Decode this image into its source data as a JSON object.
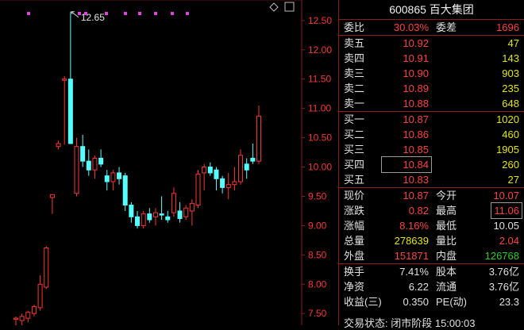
{
  "chart_data": {
    "type": "candlestick",
    "y_ticks": [
      "12.50",
      "12.00",
      "11.50",
      "11.00",
      "10.50",
      "10.00",
      "9.50",
      "9.00",
      "8.50",
      "8.00",
      "7.50"
    ],
    "y_tick_values": [
      12.5,
      12.0,
      11.5,
      11.0,
      10.5,
      10.0,
      9.5,
      9.0,
      8.5,
      8.0,
      7.5
    ],
    "ylim": [
      7.3,
      12.85
    ],
    "high_annotation": "12.65",
    "high_value": 12.65,
    "up_color": "#ff3333",
    "down_color": "#54ffff",
    "marker_color": "#e040e0",
    "candles": [
      {
        "o": 7.4,
        "h": 7.45,
        "l": 7.3,
        "c": 7.42
      },
      {
        "o": 7.38,
        "h": 7.5,
        "l": 7.3,
        "c": 7.45
      },
      {
        "o": 7.42,
        "h": 7.55,
        "l": 7.35,
        "c": 7.52
      },
      {
        "o": 7.5,
        "h": 7.65,
        "l": 7.45,
        "c": 7.62
      },
      {
        "o": 7.6,
        "h": 8.15,
        "l": 7.55,
        "c": 8.0
      },
      {
        "o": 7.95,
        "h": 8.65,
        "l": 7.92,
        "c": 8.62
      },
      {
        "o": 9.48,
        "h": 9.5,
        "l": 9.2,
        "c": 9.53
      },
      {
        "o": 10.35,
        "h": 10.45,
        "l": 10.3,
        "c": 10.4
      },
      {
        "o": 11.48,
        "h": 11.55,
        "l": 10.38,
        "c": 11.5
      },
      {
        "o": 11.5,
        "h": 12.65,
        "l": 10.4,
        "c": 10.4
      },
      {
        "o": 9.55,
        "h": 10.5,
        "l": 9.5,
        "c": 10.35
      },
      {
        "o": 10.35,
        "h": 10.55,
        "l": 10.0,
        "c": 10.1
      },
      {
        "o": 10.1,
        "h": 10.3,
        "l": 9.85,
        "c": 9.95
      },
      {
        "o": 9.95,
        "h": 10.2,
        "l": 9.8,
        "c": 10.15
      },
      {
        "o": 10.15,
        "h": 10.3,
        "l": 10.0,
        "c": 10.05
      },
      {
        "o": 9.85,
        "h": 9.95,
        "l": 9.6,
        "c": 9.75
      },
      {
        "o": 9.75,
        "h": 9.95,
        "l": 9.6,
        "c": 9.9
      },
      {
        "o": 9.9,
        "h": 10.0,
        "l": 9.7,
        "c": 9.8
      },
      {
        "o": 9.85,
        "h": 9.9,
        "l": 9.25,
        "c": 9.35
      },
      {
        "o": 9.35,
        "h": 9.4,
        "l": 9.05,
        "c": 9.15
      },
      {
        "o": 9.15,
        "h": 9.25,
        "l": 8.95,
        "c": 9.0
      },
      {
        "o": 9.0,
        "h": 9.25,
        "l": 8.95,
        "c": 9.2
      },
      {
        "o": 9.2,
        "h": 9.3,
        "l": 9.05,
        "c": 9.1
      },
      {
        "o": 9.15,
        "h": 9.3,
        "l": 9.0,
        "c": 9.22
      },
      {
        "o": 9.2,
        "h": 9.5,
        "l": 9.1,
        "c": 9.18
      },
      {
        "o": 9.15,
        "h": 9.25,
        "l": 9.05,
        "c": 9.1
      },
      {
        "o": 9.22,
        "h": 9.65,
        "l": 9.15,
        "c": 9.55
      },
      {
        "o": 9.25,
        "h": 9.4,
        "l": 9.05,
        "c": 9.12
      },
      {
        "o": 9.15,
        "h": 9.35,
        "l": 9.1,
        "c": 9.3
      },
      {
        "o": 9.25,
        "h": 9.45,
        "l": 9.0,
        "c": 9.38
      },
      {
        "o": 9.35,
        "h": 9.95,
        "l": 9.3,
        "c": 9.88
      },
      {
        "o": 9.9,
        "h": 10.05,
        "l": 9.6,
        "c": 10.0
      },
      {
        "o": 10.0,
        "h": 10.08,
        "l": 9.85,
        "c": 9.9
      },
      {
        "o": 9.95,
        "h": 10.0,
        "l": 9.6,
        "c": 9.8
      },
      {
        "o": 9.8,
        "h": 9.85,
        "l": 9.55,
        "c": 9.65
      },
      {
        "o": 9.65,
        "h": 9.9,
        "l": 9.45,
        "c": 9.7
      },
      {
        "o": 9.7,
        "h": 10.0,
        "l": 9.6,
        "c": 9.75
      },
      {
        "o": 9.75,
        "h": 10.3,
        "l": 9.7,
        "c": 10.2
      },
      {
        "o": 10.05,
        "h": 10.15,
        "l": 9.8,
        "c": 9.95
      },
      {
        "o": 10.15,
        "h": 10.4,
        "l": 10.05,
        "c": 10.1
      },
      {
        "o": 10.1,
        "h": 11.05,
        "l": 10.05,
        "c": 10.87
      }
    ]
  },
  "panel": {
    "title": "600865 百大集团",
    "weibi_label": "委比",
    "weibi": "30.03%",
    "weicha_label": "委差",
    "weicha": "1696",
    "asks": [
      {
        "label": "卖五",
        "price": "10.92",
        "vol": "47"
      },
      {
        "label": "卖四",
        "price": "10.91",
        "vol": "143"
      },
      {
        "label": "卖三",
        "price": "10.90",
        "vol": "903"
      },
      {
        "label": "卖二",
        "price": "10.89",
        "vol": "235"
      },
      {
        "label": "卖一",
        "price": "10.88",
        "vol": "648"
      }
    ],
    "bids": [
      {
        "label": "买一",
        "price": "10.87",
        "vol": "1020"
      },
      {
        "label": "买二",
        "price": "10.86",
        "vol": "460"
      },
      {
        "label": "买三",
        "price": "10.85",
        "vol": "1905"
      },
      {
        "label": "买四",
        "price": "10.84",
        "vol": "260"
      },
      {
        "label": "买五",
        "price": "10.83",
        "vol": "27"
      }
    ],
    "stats": [
      {
        "l1": "现价",
        "v1": "10.87",
        "c1": "red",
        "l2": "今开",
        "v2": "10.07",
        "c2": "red"
      },
      {
        "l1": "涨跌",
        "v1": "0.82",
        "c1": "red",
        "l2": "最高",
        "v2": "11.06",
        "c2": "red",
        "box2": true
      },
      {
        "l1": "涨幅",
        "v1": "8.16%",
        "c1": "red",
        "l2": "最低",
        "v2": "10.05",
        "c2": "wht"
      },
      {
        "l1": "总量",
        "v1": "278639",
        "c1": "yel",
        "l2": "量比",
        "v2": "2.04",
        "c2": "red"
      },
      {
        "l1": "外盘",
        "v1": "151871",
        "c1": "red",
        "l2": "内盘",
        "v2": "126768",
        "c2": "grn"
      }
    ],
    "stats2": [
      {
        "l1": "换手",
        "v1": "7.41%",
        "l2": "股本",
        "v2": "3.76亿"
      },
      {
        "l1": "净资",
        "v1": "6.22",
        "l2": "流通",
        "v2": "3.76亿"
      },
      {
        "l1": "收益(三)",
        "v1": "0.350",
        "l2": "PE(动)",
        "v2": "23.3"
      }
    ],
    "status": "交易状态: 闭市阶段 15:00:03"
  }
}
